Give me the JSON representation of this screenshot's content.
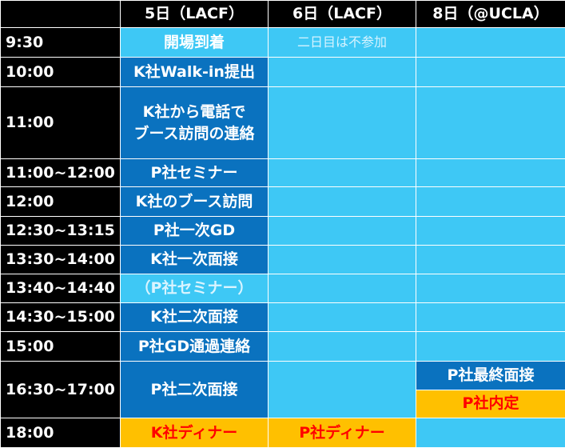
{
  "header": {
    "corner": "",
    "day1": "5日（LACF）",
    "day2": "6日（LACF）",
    "day3": "8日（@UCLA）"
  },
  "rows": [
    {
      "time": "9:30",
      "d1": "開場到着",
      "d2": "二日目は不参加",
      "d3": ""
    },
    {
      "time": "10:00",
      "d1": "K社Walk-in提出",
      "d2": "",
      "d3": ""
    },
    {
      "time": "11:00",
      "d1_line1": "K社から電話で",
      "d1_line2": "ブース訪問の連絡",
      "d2": "",
      "d3": ""
    },
    {
      "time": "11:00~12:00",
      "d1": "P社セミナー",
      "d2": "",
      "d3": ""
    },
    {
      "time": "12:00",
      "d1": "K社のブース訪問",
      "d2": "",
      "d3": ""
    },
    {
      "time": "12:30~13:15",
      "d1": "P社一次GD",
      "d2": "",
      "d3": ""
    },
    {
      "time": "13:30~14:00",
      "d1": "K社一次面接",
      "d2": "",
      "d3": ""
    },
    {
      "time": "13:40~14:40",
      "d1": "（P社セミナー）",
      "d2": "",
      "d3": ""
    },
    {
      "time": "14:30~15:00",
      "d1": "K社二次面接",
      "d2": "",
      "d3": ""
    },
    {
      "time": "15:00",
      "d1": "P社GD通過連絡",
      "d2": "",
      "d3": ""
    },
    {
      "time": "16:30~17:00",
      "d1": "P社二次面接",
      "d2": "",
      "d3_top": "P社最終面接",
      "d3_bottom": "P社内定"
    },
    {
      "time": "18:00",
      "d1": "K社ディナー",
      "d2": "P社ディナー",
      "d3": ""
    }
  ],
  "colors": {
    "header_bg": "#000000",
    "light_cell": "#3ec8f5",
    "dark_cell": "#0a72bf",
    "highlight_cell": "#ffc000",
    "highlight_text": "#ff0000"
  }
}
